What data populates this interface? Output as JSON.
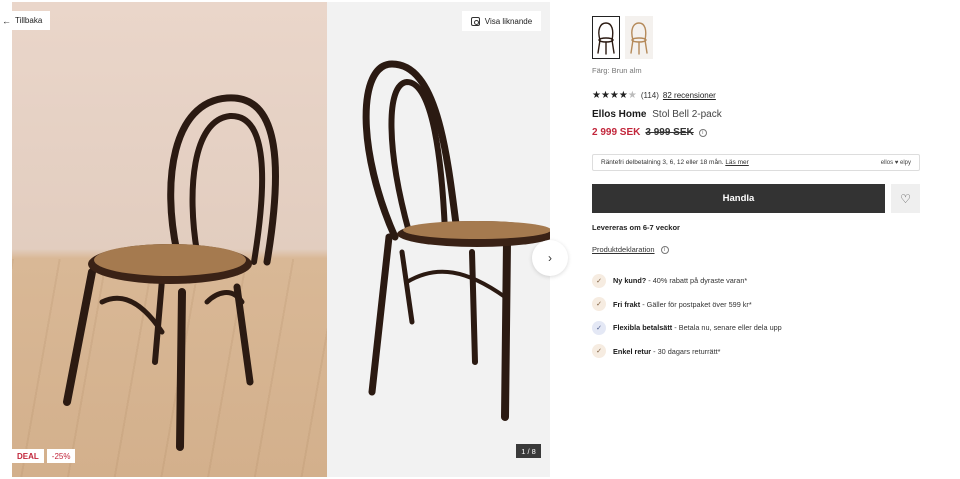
{
  "gallery": {
    "back_label": "Tillbaka",
    "similar_label": "Visa liknande",
    "counter": "1 / 8",
    "deal_label": "DEAL",
    "discount_label": "-25%"
  },
  "product": {
    "color_label": "Färg: Brun alm",
    "rating_value": 3.5,
    "rating_count": "(114)",
    "reviews_link": "82 recensioner",
    "brand": "Ellos Home",
    "name": "Stol Bell 2-pack",
    "price_now": "2 999 SEK",
    "price_old": "3 999 SEK",
    "installments_text": "Räntefri delbetalning 3, 6, 12 eller 18 mån.",
    "installments_link": "Läs mer",
    "installments_logo": "ellos ♥ elpy",
    "buy_label": "Handla",
    "delivery": "Levereras om 6-7 veckor",
    "declaration_link": "Produktdeklaration"
  },
  "usps": [
    {
      "title": "Ny kund?",
      "text": " - 40% rabatt på dyraste varan*"
    },
    {
      "title": "Fri frakt",
      "text": " - Gäller för postpaket över 599 kr*"
    },
    {
      "title": "Flexibla betalsätt",
      "text": " - Betala nu, senare eller dela upp"
    },
    {
      "title": "Enkel retur",
      "text": " - 30 dagars returrätt*"
    }
  ],
  "colors": {
    "accent_price": "#c2263b",
    "buy_button": "#333333"
  }
}
